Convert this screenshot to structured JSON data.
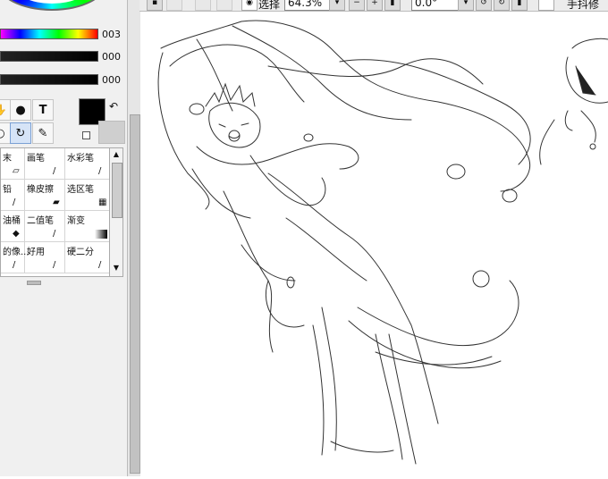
{
  "color_panel": {
    "hue_value": "003",
    "slider2_value": "000",
    "slider3_value": "000"
  },
  "tool_icons": {
    "text_tool": "T",
    "swap_icon": "↶"
  },
  "brush_list": {
    "items": [
      {
        "label": "末",
        "icon": "eraser-icon"
      },
      {
        "label": "画笔",
        "icon": "pen-icon"
      },
      {
        "label": "水彩笔",
        "icon": "brush-icon"
      },
      {
        "label": "铅",
        "icon": "pencil-icon"
      },
      {
        "label": "橡皮擦",
        "icon": "eraser-icon"
      },
      {
        "label": "选区笔",
        "icon": "selpen-icon"
      },
      {
        "label": "油桶",
        "icon": "bucket-icon"
      },
      {
        "label": "二值笔",
        "icon": "binary-pen-icon"
      },
      {
        "label": "渐变",
        "icon": "gradient-icon"
      },
      {
        "label": "的像...",
        "icon": "pen-icon"
      },
      {
        "label": "好用",
        "icon": "pen-icon"
      },
      {
        "label": "硬二分",
        "icon": "pen-icon"
      }
    ]
  },
  "toolbar": {
    "select_label": "选择",
    "zoom_value": "64.3%",
    "rotation_value": "0.0°",
    "stabilizer_label": "手抖修正"
  },
  "colors": {
    "foreground": "#000000",
    "background": "#cfcfcf",
    "panel_bg": "#f0f0f0"
  }
}
